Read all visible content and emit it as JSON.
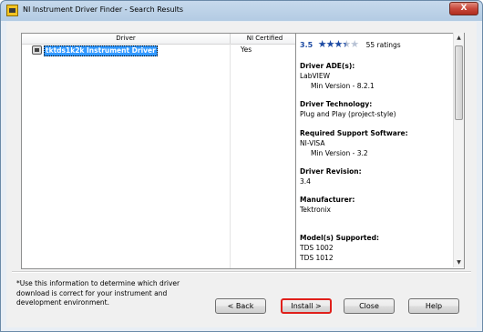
{
  "window": {
    "title": "NI Instrument Driver Finder - Search Results",
    "close_glyph": "X"
  },
  "table": {
    "columns": [
      "Driver",
      "NI Certified"
    ],
    "rows": [
      {
        "driver": "tktds1k2k Instrument Driver",
        "certified": "Yes",
        "selected": true
      }
    ]
  },
  "details": {
    "rating": "3.5",
    "stars_filled": "★★★",
    "stars_half": "★",
    "stars_empty": "★",
    "ratings_count": "55 ratings",
    "sections": [
      {
        "heading": "Driver ADE(s):",
        "lines": [
          "LabVIEW"
        ],
        "indented": [
          "Min Version - 8.2.1"
        ]
      },
      {
        "heading": "Driver Technology:",
        "lines": [
          "Plug and Play (project-style)"
        ],
        "indented": []
      },
      {
        "heading": "Required Support Software:",
        "lines": [
          "NI-VISA"
        ],
        "indented": [
          "Min Version - 3.2"
        ]
      },
      {
        "heading": "Driver Revision:",
        "lines": [
          "3.4"
        ],
        "indented": []
      },
      {
        "heading": "Manufacturer:",
        "lines": [
          "Tektronix"
        ],
        "indented": []
      },
      {
        "heading": "Model(s) Supported:",
        "lines": [
          "TDS 1002",
          "TDS 1012"
        ],
        "indented": []
      }
    ]
  },
  "footnote": "*Use this information to determine which driver download is correct for your instrument and development environment.",
  "buttons": {
    "back": "< Back",
    "install": "Install >",
    "close": "Close",
    "help": "Help"
  },
  "colors": {
    "selection": "#3399ff",
    "rating": "#1e4ba3",
    "install_highlight": "#e0201b"
  },
  "icons": {
    "app": "instrument-driver-icon",
    "row": "instrument-icon",
    "close": "close-icon"
  }
}
